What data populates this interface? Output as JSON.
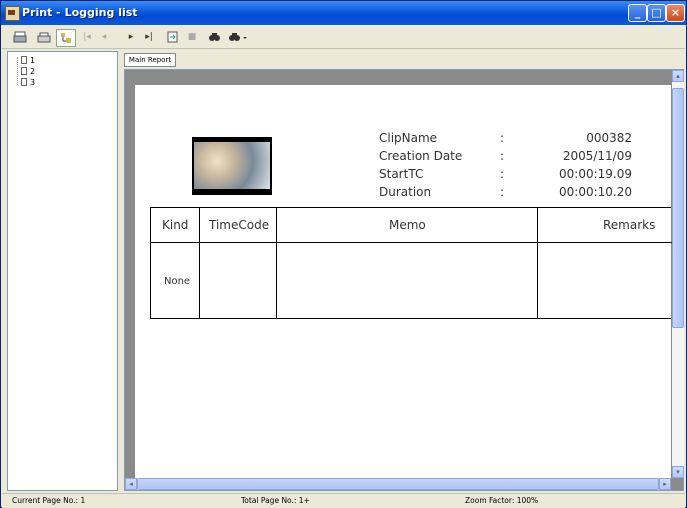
{
  "window": {
    "title": "Print - Logging list"
  },
  "toolbar": {
    "buttons": [
      "print-icon",
      "print-setup-icon",
      "tree-toggle-icon",
      "first-page-icon",
      "previous-page-icon",
      "next-page-icon",
      "last-page-icon",
      "goto-page-icon",
      "stop-icon",
      "find-icon",
      "zoom-icon"
    ]
  },
  "tree": {
    "items": [
      "1",
      "2",
      "3"
    ]
  },
  "tab": {
    "label": "Main Report"
  },
  "report": {
    "meta": [
      {
        "label": "ClipName",
        "sep": ":",
        "value": "000382"
      },
      {
        "label": "Creation Date",
        "sep": ":",
        "value": "2005/11/09"
      },
      {
        "label": "StartTC",
        "sep": ":",
        "value": "00:00:19.09"
      },
      {
        "label": "Duration",
        "sep": ":",
        "value": "00:00:10.20"
      }
    ],
    "columns": [
      "Kind",
      "TimeCode",
      "Memo",
      "Remarks"
    ],
    "rows": [
      {
        "kind": "None",
        "timecode": "",
        "memo": "",
        "remarks": ""
      }
    ]
  },
  "status": {
    "current_page": "Current Page No.: 1",
    "total_page": "Total Page No.: 1+",
    "zoom": "Zoom Factor: 100%"
  }
}
